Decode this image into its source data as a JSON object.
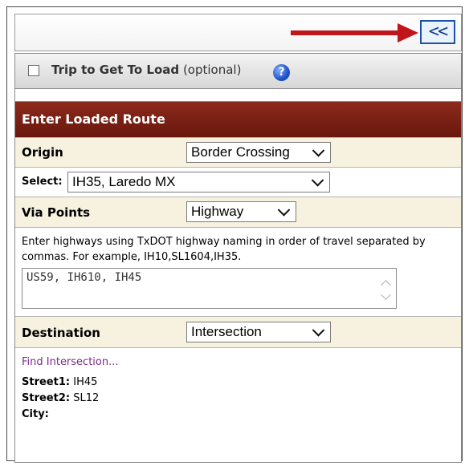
{
  "toolbar": {
    "collapse_label": "<<"
  },
  "trip": {
    "label_bold": "Trip to Get To Load",
    "label_optional": "(optional)",
    "help_glyph": "?"
  },
  "route": {
    "header": "Enter Loaded Route",
    "origin": {
      "label": "Origin",
      "value": "Border Crossing"
    },
    "select": {
      "label": "Select:",
      "value": "IH35, Laredo MX"
    },
    "via": {
      "label": "Via Points",
      "value": "Highway",
      "description": "Enter highways using TxDOT highway naming in order of travel separated by commas. For example, IH10,SL1604,IH35.",
      "text": "US59, IH610, IH45"
    },
    "destination": {
      "label": "Destination",
      "value": "Intersection",
      "find_link": "Find Intersection...",
      "street1_label": "Street1:",
      "street1_value": "IH45",
      "street2_label": "Street2:",
      "street2_value": "SL12",
      "city_label": "City:",
      "city_value": ""
    }
  },
  "colors": {
    "header_bg": "#7a1f14",
    "row_beige": "#f7f1df",
    "arrow": "#c0151b",
    "link": "#7b2b89"
  }
}
